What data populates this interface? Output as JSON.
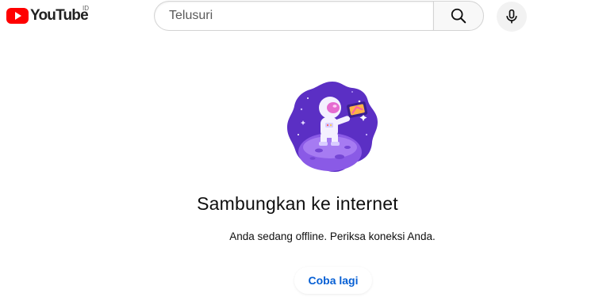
{
  "header": {
    "logo_text": "YouTube",
    "region": "ID",
    "search": {
      "placeholder": "Telusuri",
      "value": ""
    },
    "search_icon": "search-icon",
    "mic_icon": "microphone-icon"
  },
  "offline": {
    "illustration": "astronaut-on-planet-illustration",
    "title": "Sambungkan ke internet",
    "message": "Anda sedang offline. Periksa koneksi Anda.",
    "retry_label": "Coba lagi"
  },
  "colors": {
    "brand_red": "#ff0000",
    "link_blue": "#065fd4",
    "illustration_purple": "#5b2fc4"
  }
}
